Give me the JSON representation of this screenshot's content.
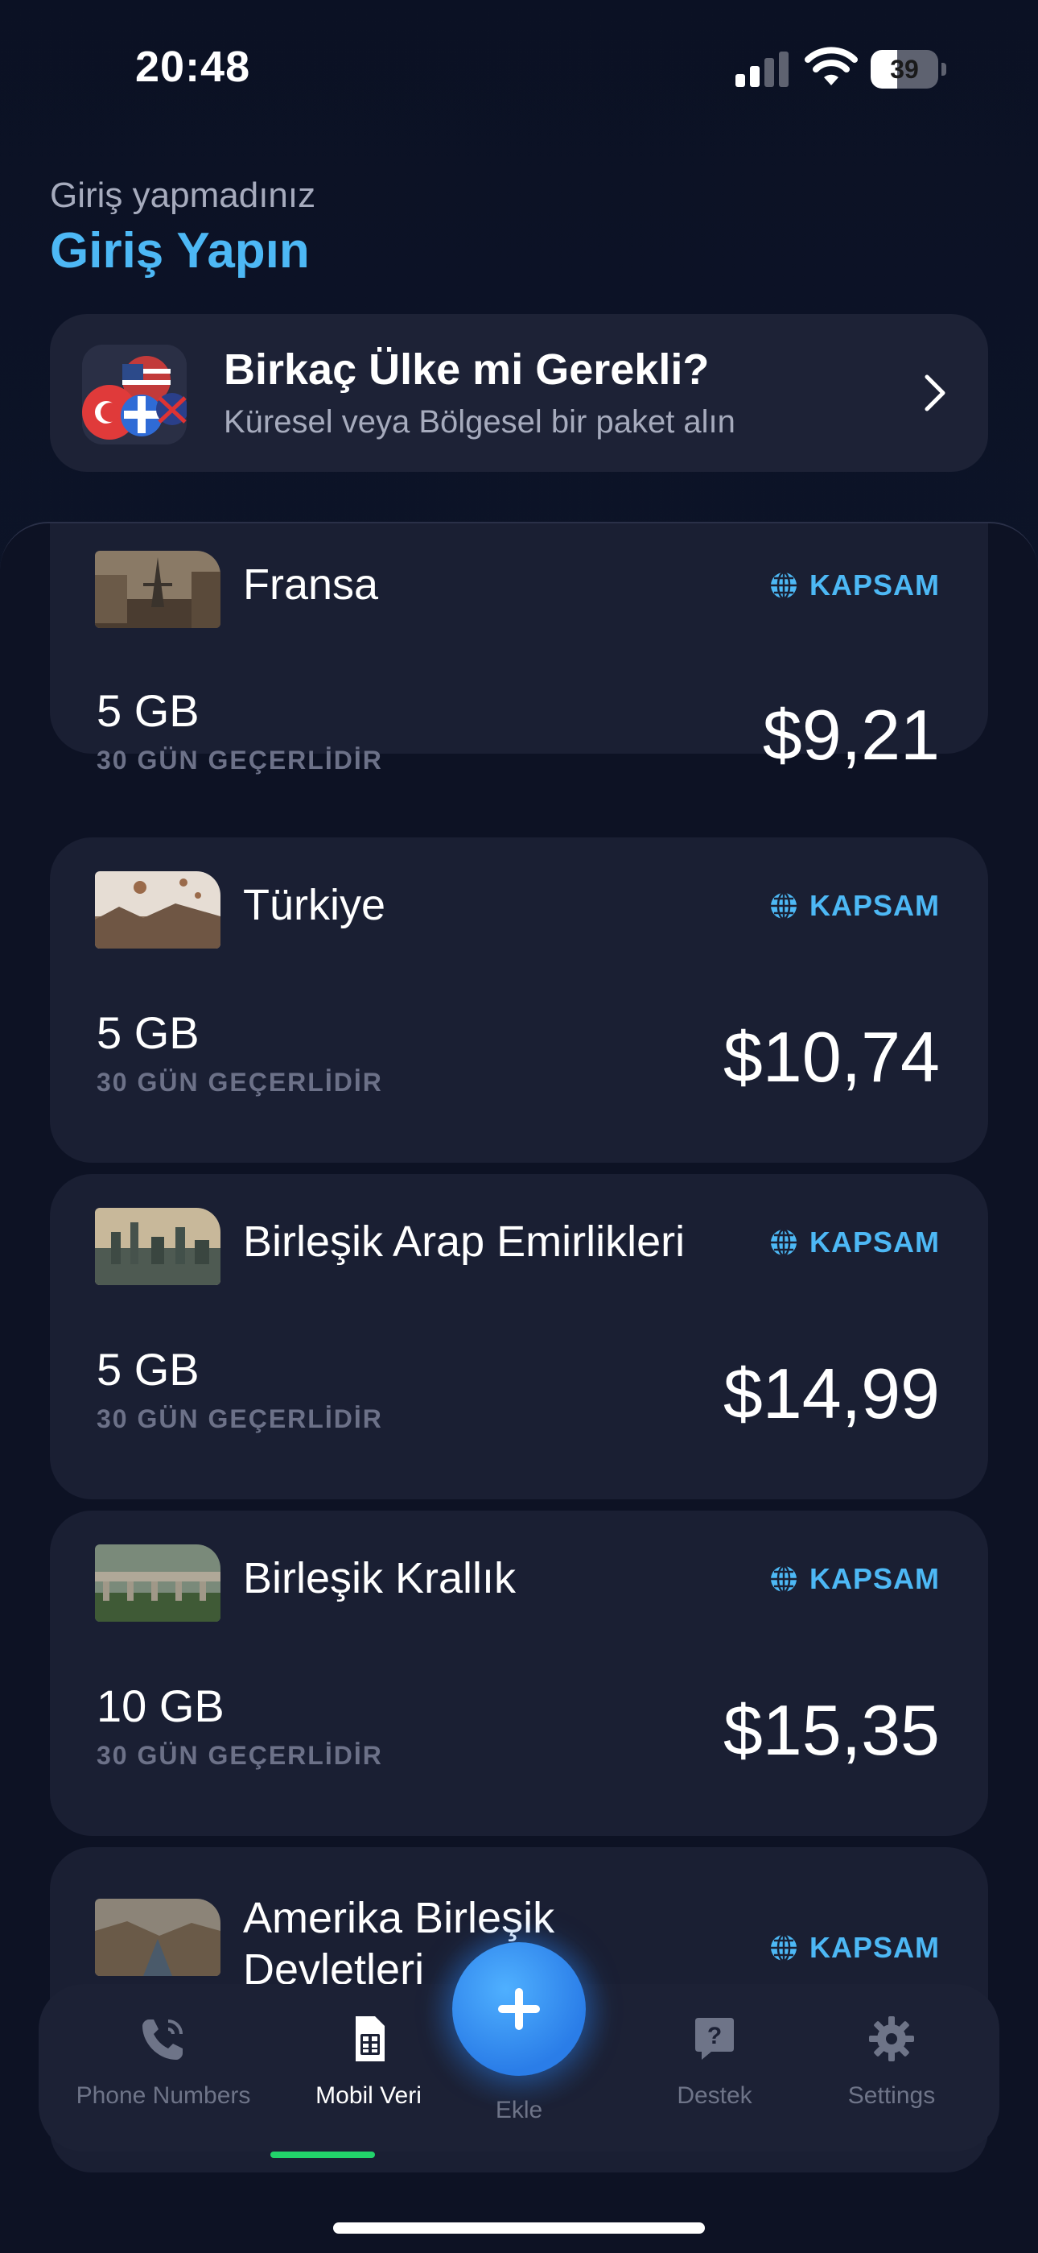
{
  "status_bar": {
    "time": "20:48",
    "battery_level": "39",
    "battery_fraction": 0.39
  },
  "login": {
    "subtitle": "Giriş yapmadınız",
    "title": "Giriş Yapın"
  },
  "promo": {
    "title": "Birkaç Ülke mi Gerekli?",
    "subtitle": "Küresel veya Bölgesel bir paket alın",
    "icon": "chevron-right-icon"
  },
  "plans": [
    {
      "country": "Fransa",
      "coverage": "KAPSAM",
      "data": "5 GB",
      "validity": "30 GÜN GEÇERLİDİR",
      "price": "$9,21"
    },
    {
      "country": "Türkiye",
      "coverage": "KAPSAM",
      "data": "5 GB",
      "validity": "30 GÜN GEÇERLİDİR",
      "price": "$10,74"
    },
    {
      "country": "Birleşik Arap Emirlikleri",
      "coverage": "KAPSAM",
      "data": "5 GB",
      "validity": "30 GÜN GEÇERLİDİR",
      "price": "$14,99"
    },
    {
      "country": "Birleşik Krallık",
      "coverage": "KAPSAM",
      "data": "10 GB",
      "validity": "30 GÜN GEÇERLİDİR",
      "price": "$15,35"
    },
    {
      "country": "Amerika Birleşik Devletleri",
      "coverage": "KAPSAM"
    }
  ],
  "tabbar": {
    "tabs": [
      {
        "label": "Phone Numbers",
        "icon": "phone-icon",
        "active": false
      },
      {
        "label": "Mobil Veri",
        "icon": "sim-card-icon",
        "active": true
      },
      {
        "label": "Ekle",
        "icon": "plus-icon",
        "active": false
      },
      {
        "label": "Destek",
        "icon": "help-bubble-icon",
        "active": false
      },
      {
        "label": "Settings",
        "icon": "gear-icon",
        "active": false
      }
    ]
  },
  "colors": {
    "accent": "#4db8f5",
    "active_tab": "#22d36b",
    "card": "#1a1f33",
    "add_button": "#2a7de8"
  }
}
